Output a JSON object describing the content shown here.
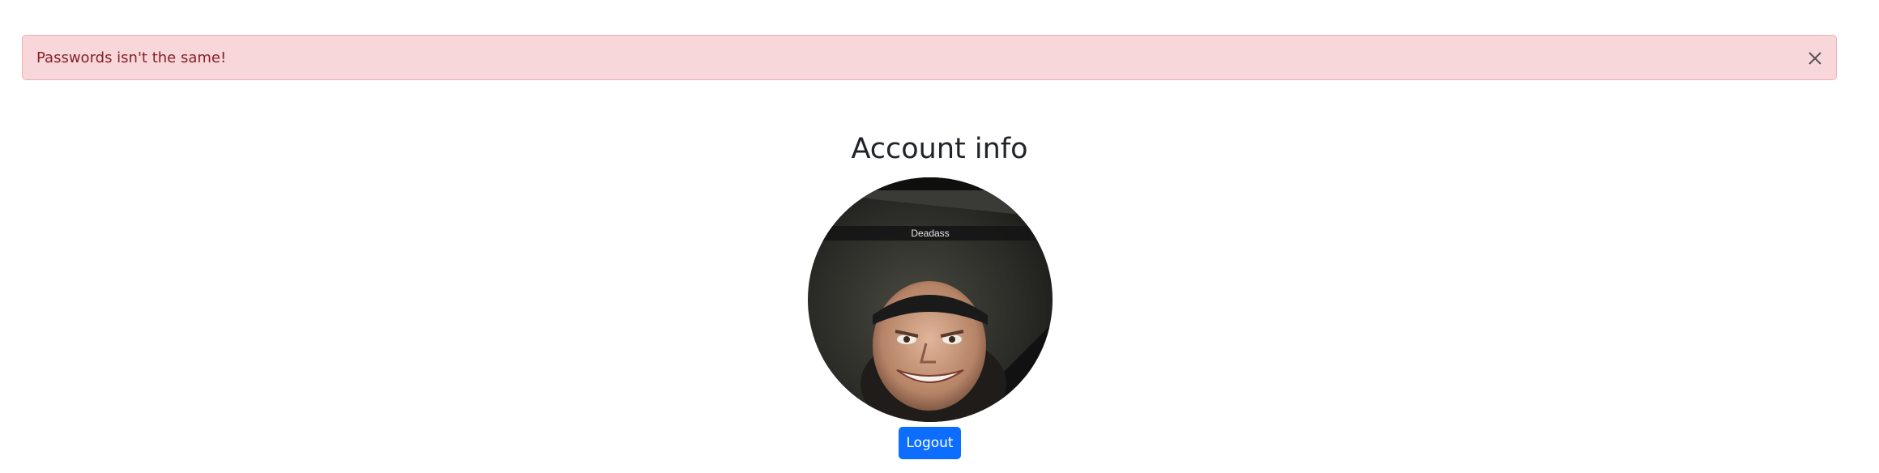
{
  "alert": {
    "message": "Passwords isn't the same!",
    "close_icon": "close-icon"
  },
  "account": {
    "title": "Account info",
    "avatar_caption": "Deadass"
  },
  "actions": {
    "logout_label": "Logout"
  },
  "colors": {
    "alert_bg": "#f8d7da",
    "alert_text": "#842029",
    "primary": "#0d6efd"
  }
}
